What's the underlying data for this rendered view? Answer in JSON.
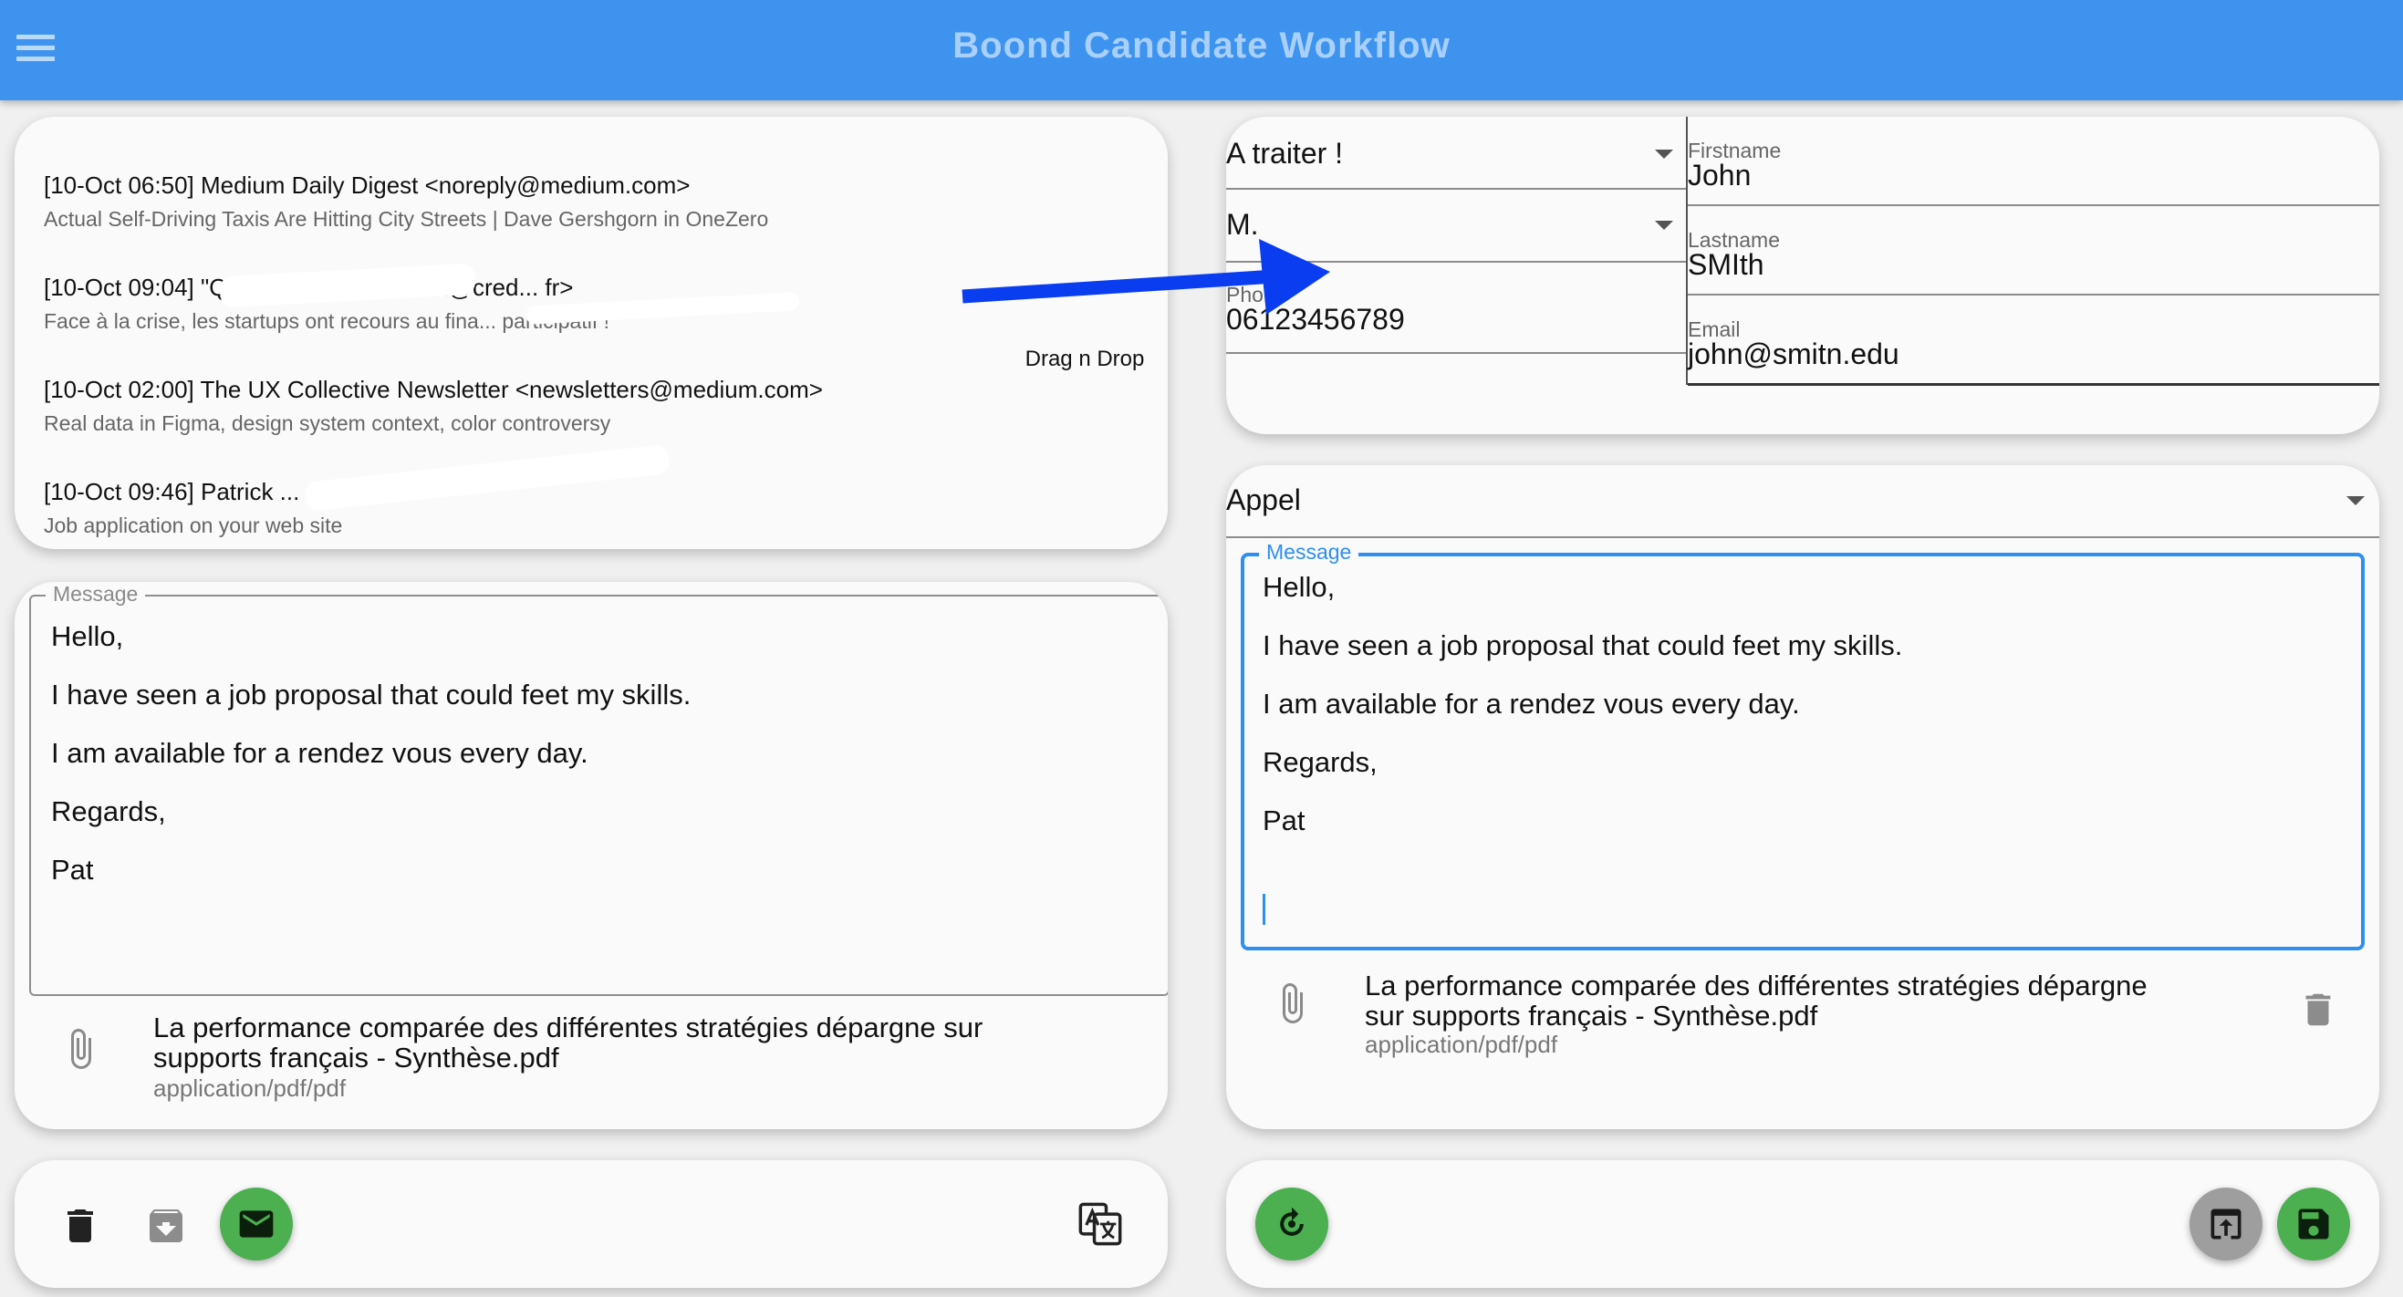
{
  "app": {
    "title": "Boond Candidate Workflow"
  },
  "email_list": {
    "tooltip": "Drag n Drop",
    "items": [
      {
        "header": "[10-Oct 06:50] Medium Daily Digest <noreply@medium.com>",
        "subject": "Actual Self-Driving Taxis Are Hitting City Streets | Dave Gershgorn in OneZero"
      },
      {
        "header": "[10-Oct 09:04] \"Quentin de ... <contact@cred... fr>",
        "subject": "Face à la crise, les startups ont recours au fina... participatif !"
      },
      {
        "header": "[10-Oct 02:00] The UX Collective Newsletter <newsletters@medium.com>",
        "subject": "Real data in Figma, design system context, color controversy"
      },
      {
        "header": "[10-Oct 09:46] Patrick ... ... @...",
        "subject": "Job application on your web site"
      }
    ]
  },
  "left_message": {
    "legend": "Message",
    "lines": [
      "Hello,",
      "I have seen a job proposal that could feet my skills.",
      "I am available for a rendez vous every day.",
      "Regards,",
      "Pat"
    ]
  },
  "left_attachment": {
    "icon": "paperclip-icon",
    "name_line1": "La performance comparée des différentes stratégies dépargne sur",
    "name_line2": "supports français - Synthèse.pdf",
    "type": "application/pdf/pdf"
  },
  "left_actions": {
    "icons": [
      "delete-icon",
      "archive-icon",
      "mail-icon",
      "translate-icon"
    ],
    "accent": "#4caf50"
  },
  "candidate_form": {
    "status": "A traiter !",
    "civility": "M.",
    "phone_label": "Phone",
    "phone_value": "06123456789",
    "firstname_label": "Firstname",
    "firstname_value": "John",
    "lastname_label": "Lastname",
    "lastname_value": "SMIth",
    "email_label": "Email",
    "email_value": "john@smitn.edu"
  },
  "action_panel": {
    "type": "Appel",
    "message_legend": "Message",
    "message_lines": [
      "Hello,",
      "I have seen a job proposal that could feet my skills.",
      "I am available for a rendez vous every day.",
      "Regards,",
      "Pat"
    ],
    "attachment": {
      "icon": "paperclip-icon",
      "name_line1": "La performance comparée des différentes stratégies dépargne",
      "name_line2": "sur supports français - Synthèse.pdf",
      "type": "application/pdf/pdf"
    }
  },
  "right_actions": {
    "icons": [
      "refresh-icon",
      "upload-icon",
      "save-icon"
    ],
    "accent": "#4caf50",
    "secondary": "#9e9e9e"
  },
  "colors": {
    "appbar": "#3e93ef",
    "focus": "#2d8ff0",
    "arrow": "#0a3df0"
  }
}
